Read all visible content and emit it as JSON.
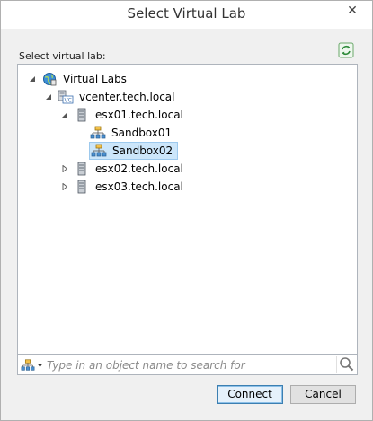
{
  "window": {
    "title": "Select Virtual Lab",
    "close_glyph": "✕"
  },
  "label": "Select virtual lab:",
  "tree": {
    "root": {
      "label": "Virtual Labs",
      "icon": "globe-icon",
      "expanded": true
    },
    "vcenter": {
      "label": "vcenter.tech.local",
      "icon": "vcenter-icon",
      "expanded": true
    },
    "hosts": [
      {
        "label": "esx01.tech.local",
        "icon": "server-icon",
        "expanded": true,
        "children": [
          {
            "label": "Sandbox01",
            "icon": "virtual-lab-icon",
            "selected": false
          },
          {
            "label": "Sandbox02",
            "icon": "virtual-lab-icon",
            "selected": true
          }
        ]
      },
      {
        "label": "esx02.tech.local",
        "icon": "server-icon",
        "expanded": false
      },
      {
        "label": "esx03.tech.local",
        "icon": "server-icon",
        "expanded": false
      }
    ]
  },
  "search": {
    "placeholder": "Type in an object name to search for",
    "value": ""
  },
  "buttons": {
    "connect": "Connect",
    "cancel": "Cancel"
  },
  "colors": {
    "selection_bg": "#cce6fa",
    "selection_border": "#9dc9ed",
    "accent": "#3c7fb1"
  }
}
